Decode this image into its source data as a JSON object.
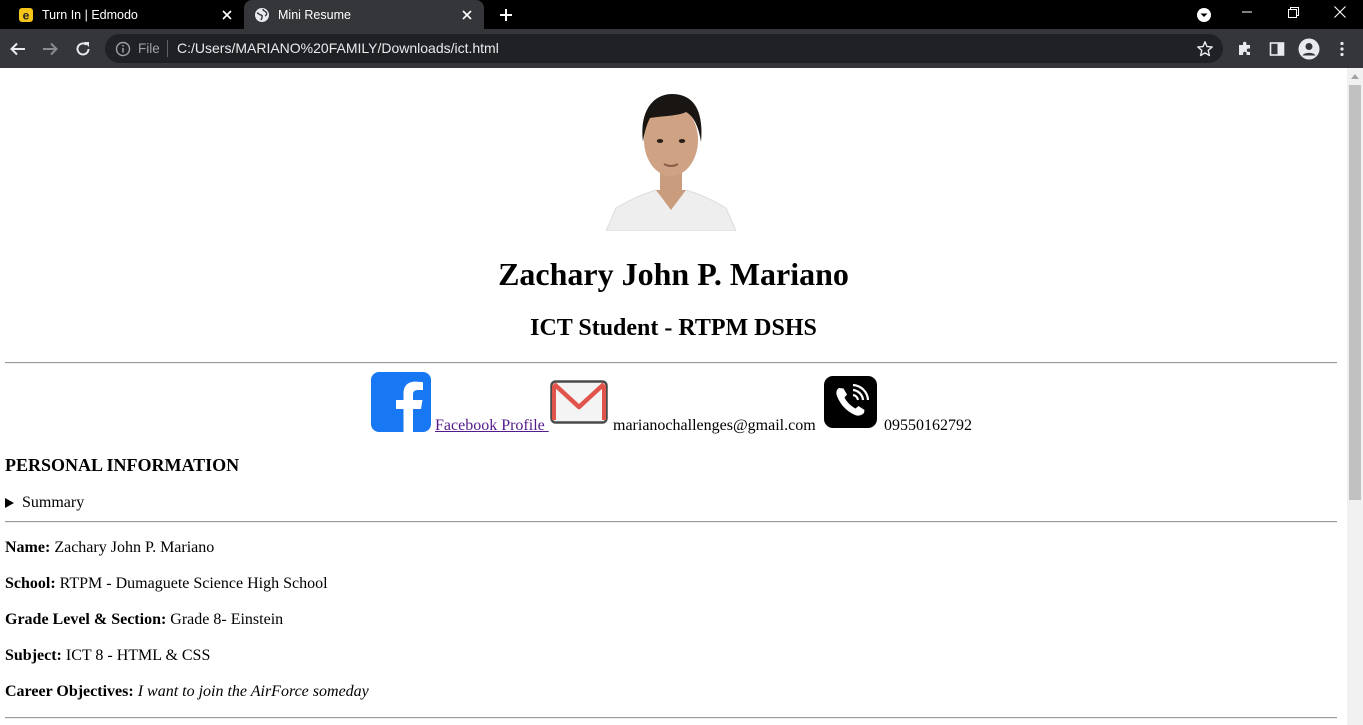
{
  "browser": {
    "tabs": [
      {
        "label": "Turn In | Edmodo",
        "active": false,
        "icon": "edmodo-favicon"
      },
      {
        "label": "Mini Resume",
        "active": true,
        "icon": "globe-favicon"
      }
    ],
    "omnibox": {
      "scheme_label": "File",
      "url": "C:/Users/MARIANO%20FAMILY/Downloads/ict.html"
    }
  },
  "colors": {
    "tab_strip": "#000000",
    "toolbar": "#35363a",
    "omnibox": "#202124",
    "visited_link": "#551a8b",
    "facebook_blue": "#1877f2"
  },
  "page": {
    "name": "Zachary John P. Mariano",
    "role": "ICT Student - RTPM DSHS",
    "contacts": {
      "facebook_label": "Facebook Profile ",
      "email": "marianochallenges@gmail.com",
      "phone": "09550162792"
    },
    "section_title": "PERSONAL INFORMATION",
    "summary_label": "Summary",
    "fields": [
      {
        "label": "Name:",
        "value": "Zachary John P. Mariano"
      },
      {
        "label": "School:",
        "value": "RTPM - Dumaguete Science High School"
      },
      {
        "label": "Grade Level & Section:",
        "value": "Grade 8- Einstein"
      },
      {
        "label": "Subject:",
        "value": "ICT 8 - HTML & CSS"
      },
      {
        "label": "Career Objectives:",
        "value": "I want to join the AirForce someday"
      }
    ]
  }
}
